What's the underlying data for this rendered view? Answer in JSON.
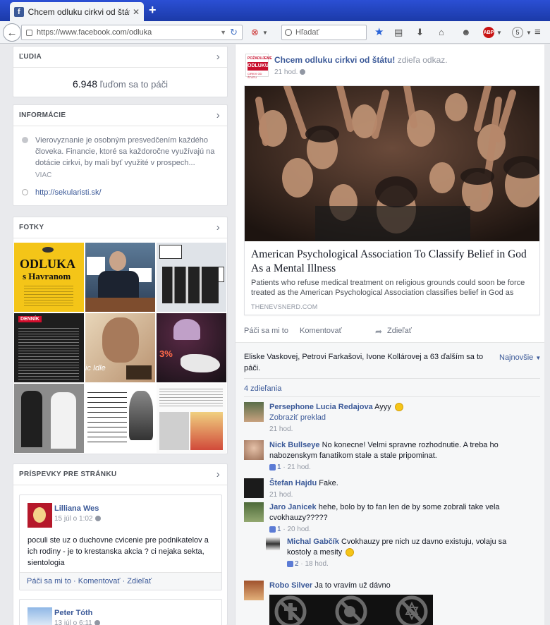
{
  "browser": {
    "tab_title": "Chcem odluku cirkvi od štátu! ...",
    "url": "https://www.facebook.com/odluka",
    "search_placeholder": "Hľadať",
    "abp_label": "ABP",
    "badge_count": "5"
  },
  "left": {
    "people": {
      "header": "ĽUDIA",
      "count": "6.948",
      "likes_text": "ľuďom sa to páči"
    },
    "info": {
      "header": "INFORMÁCIE",
      "description": "Vierovyznanie je osobným presvedčením každého človeka. Financie, ktoré sa každoročne využívajú na dotácie cirkvi, by mali byť využité v prospech...",
      "more": "VIAC",
      "link": "http://sekularisti.sk/"
    },
    "photos": {
      "header": "FOTKY",
      "photo1_title": "ODLUKA",
      "photo1_subtitle": "s Havranom",
      "photo4_brand": "DENNÍK",
      "photo6_percent": "3%",
      "photo5_text": "ic Idle"
    },
    "posts": {
      "header": "PRÍSPEVKY PRE STRÁNKU",
      "post1": {
        "author": "Lilliana Wes",
        "date": "15 júl o 1:02",
        "text": "poculi ste uz o duchovne cvicenie pre podnikatelov a ich rodiny - je to krestanska akcia ? ci nejaka sekta, sientologia",
        "actions": "Páči sa mi to · Komentovať · Zdieľať"
      },
      "post2": {
        "author": "Peter Tóth",
        "date": "13 júl o 6:11"
      }
    }
  },
  "feed": {
    "page_name": "Chcem odluku cirkvi od štátu!",
    "shared_text": "zdieľa odkaz.",
    "time": "21 hod.",
    "logo": {
      "line1": "POŽADUJEME",
      "line2": "ODLUKU",
      "line3": "CIRKVI OD ŠTÁTU"
    },
    "link": {
      "title": "American Psychological Association To Classify Belief in God As a Mental Illness",
      "description": "Patients who refuse medical treatment on religious grounds could soon be force treated as the American Psychological Association classifies belief in God as",
      "domain": "THENEVSNERD.COM"
    },
    "actions": {
      "like": "Páči sa mi to",
      "comment": "Komentovať",
      "share": "Zdieľať"
    },
    "likers": "Eliske Vaskovej, Petrovi Farkašovi, Ivone Kollárovej a 63 ďalším sa to páči.",
    "sort": "Najnovšie",
    "shares": "4 zdieľania",
    "comments": [
      {
        "name": "Persephone Lucia Redajova",
        "text": "Ayyy",
        "translate": "Zobraziť preklad",
        "time": "21 hod.",
        "likes": ""
      },
      {
        "name": "Nick Bullseye",
        "text": "No konecne! Velmi spravne rozhodnutie. A treba ho nabozenskym fanatikom stale a stale pripominat.",
        "time": "21 hod.",
        "likes": "1"
      },
      {
        "name": "Štefan Hajdu",
        "text": "Fake.",
        "time": "21 hod.",
        "likes": ""
      },
      {
        "name": "Jaro Janicek",
        "text": "hehe, bolo by to fan len de by some zobrali take vela cvokhauzy?????",
        "time": "20 hod.",
        "likes": "1"
      },
      {
        "name": "Michal Gabčík",
        "text": "Cvokhauzy pre nich uz davno existuju, volaju sa kostoly a mesity",
        "time": "18 hod.",
        "likes": "2"
      },
      {
        "name": "Robo Silver",
        "text": "Ja to vravím už dávno",
        "time": "",
        "likes": ""
      }
    ]
  },
  "colors": {
    "facebook_blue": "#3b5998",
    "tab_bar": "#2b4fd4",
    "logo_red": "#c8102e"
  }
}
